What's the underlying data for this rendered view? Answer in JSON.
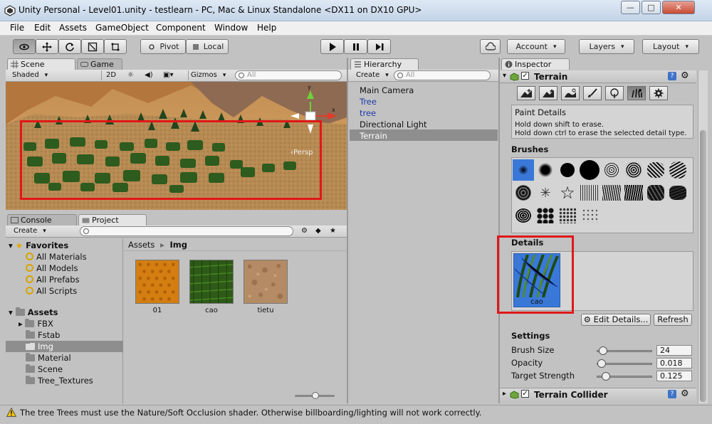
{
  "window": {
    "title": "Unity Personal - Level01.unity - testlearn - PC, Mac & Linux Standalone <DX11 on DX10 GPU>",
    "minimize": "—",
    "maximize": "□",
    "close": "✕"
  },
  "menu": [
    "File",
    "Edit",
    "Assets",
    "GameObject",
    "Component",
    "Window",
    "Help"
  ],
  "toolbar": {
    "pivot": "Pivot",
    "local": "Local",
    "account": "Account",
    "layers": "Layers",
    "layout": "Layout"
  },
  "scene_panel": {
    "tabs": [
      "Scene",
      "Game"
    ],
    "shading": "Shaded",
    "mode_2d": "2D",
    "gizmos": "Gizmos",
    "search_placeholder": "All",
    "axis_y": "y",
    "axis_x": "x",
    "persp": "‹Persp"
  },
  "hierarchy": {
    "tab": "Hierarchy",
    "create": "Create",
    "search_placeholder": "All",
    "items": [
      {
        "label": "Main Camera",
        "color": "#111111"
      },
      {
        "label": "Tree",
        "color": "#1f3aa8"
      },
      {
        "label": "tree",
        "color": "#1f3aa8"
      },
      {
        "label": "Directional Light",
        "color": "#111111"
      },
      {
        "label": "Terrain",
        "color": "#ffffff"
      }
    ]
  },
  "bottom_panel": {
    "tabs": [
      "Console",
      "Project"
    ],
    "create": "Create",
    "favorites_label": "Favorites",
    "favorites": [
      "All Materials",
      "All Models",
      "All Prefabs",
      "All Scripts"
    ],
    "assets_label": "Assets",
    "folders": [
      "FBX",
      "Fstab",
      "Img",
      "Material",
      "Scene",
      "Tree_Textures"
    ],
    "breadcrumb_root": "Assets",
    "breadcrumb_sep": "▸",
    "breadcrumb_current": "Img",
    "assets": [
      "01",
      "cao",
      "tietu"
    ]
  },
  "inspector": {
    "tab": "Inspector",
    "component": "Terrain",
    "help_title": "Paint Details",
    "help_line1": "Hold down shift to erase.",
    "help_line2": "Hold down ctrl to erase the selected detail type.",
    "brushes_label": "Brushes",
    "details_label": "Details",
    "detail_item": "cao",
    "edit_details": "Edit Details...",
    "refresh": "Refresh",
    "settings_label": "Settings",
    "brush_size_label": "Brush Size",
    "brush_size_value": "24",
    "opacity_label": "Opacity",
    "opacity_value": "0.018",
    "target_strength_label": "Target Strength",
    "target_strength_value": "0.125",
    "next_component": "Terrain Collider"
  },
  "status": {
    "message": "The tree Trees must use the Nature/Soft Occlusion shader. Otherwise billboarding/lighting will not work correctly."
  },
  "colors": {
    "selection": "#8e8e8e",
    "highlight_red": "#e01818",
    "brush_selected": "#3a78d8"
  }
}
